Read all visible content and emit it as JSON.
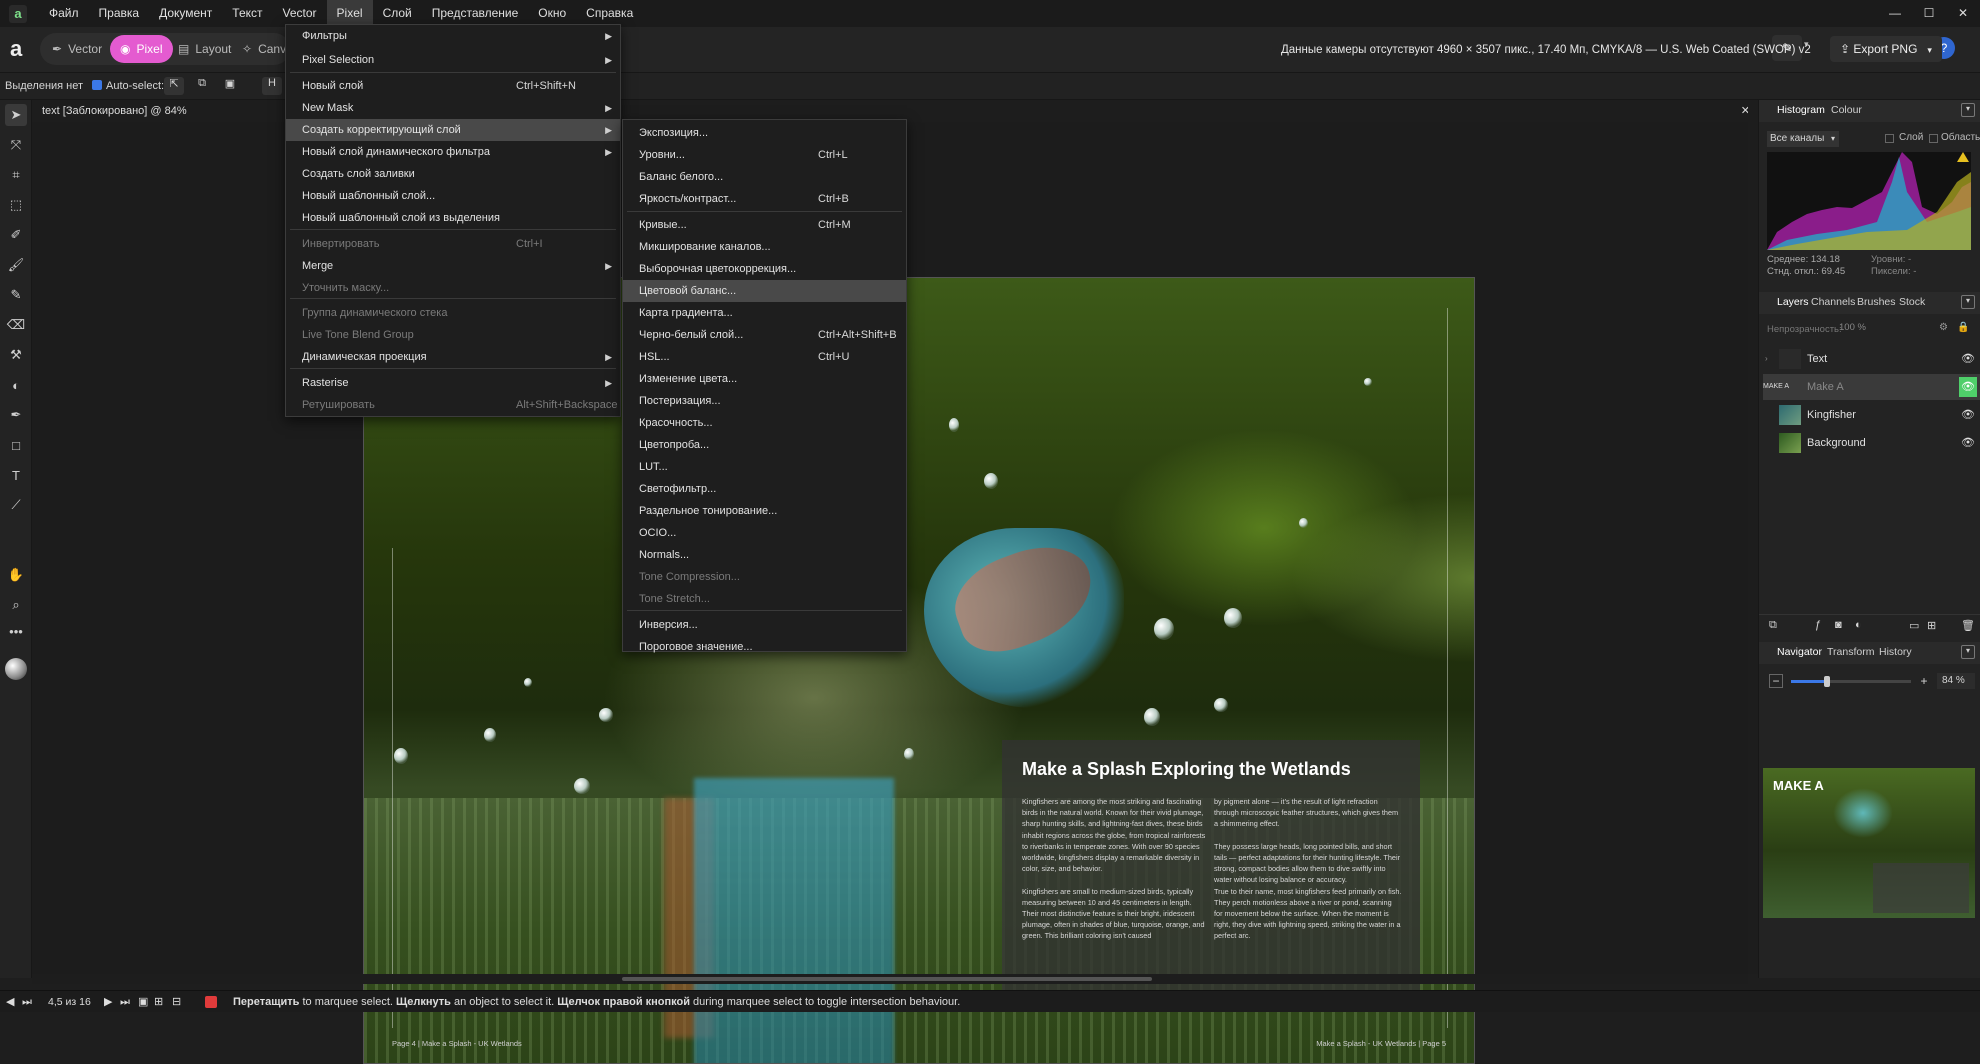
{
  "menubar": {
    "items": [
      "Файл",
      "Правка",
      "Документ",
      "Текст",
      "Vector",
      "Pixel",
      "Слой",
      "Представление",
      "Окно",
      "Справка"
    ],
    "active": "Pixel"
  },
  "toolbar": {
    "personas": [
      "Vector",
      "Pixel",
      "Layout",
      "Canva"
    ],
    "camera_info": "Данные камеры отсутствуют",
    "doc_info": "4960 × 3507 пикс., 17.40 Мп, CMYKA/8 — U.S. Web Coated (SWOP) v2",
    "export_label": "Export PNG"
  },
  "optbar": {
    "selection": "Выделения нет",
    "autoselect": "Auto-select:"
  },
  "document_tab": "text [Заблокировано] @ 84%",
  "pixel_menu": [
    {
      "label": "Фильтры",
      "shortcut": "",
      "submenu": true,
      "disabled": false
    },
    {
      "label": "Pixel Selection",
      "shortcut": "",
      "submenu": true,
      "disabled": false
    },
    {
      "label": "Новый слой",
      "shortcut": "Ctrl+Shift+N",
      "submenu": false,
      "disabled": false
    },
    {
      "label": "New Mask",
      "shortcut": "",
      "submenu": true,
      "disabled": false
    },
    {
      "label": "Создать корректирующий слой",
      "shortcut": "",
      "submenu": true,
      "disabled": false
    },
    {
      "label": "Новый слой динамического фильтра",
      "shortcut": "",
      "submenu": true,
      "disabled": false
    },
    {
      "label": "Создать слой заливки",
      "shortcut": "",
      "submenu": false,
      "disabled": false
    },
    {
      "label": "Новый шаблонный слой...",
      "shortcut": "",
      "submenu": false,
      "disabled": false
    },
    {
      "label": "Новый шаблонный слой из выделения",
      "shortcut": "",
      "submenu": false,
      "disabled": false
    },
    {
      "label": "Инвертировать",
      "shortcut": "Ctrl+I",
      "submenu": false,
      "disabled": true
    },
    {
      "label": "Merge",
      "shortcut": "",
      "submenu": true,
      "disabled": false
    },
    {
      "label": "Уточнить маску...",
      "shortcut": "",
      "submenu": false,
      "disabled": true
    },
    {
      "label": "Группа динамического стека",
      "shortcut": "",
      "submenu": false,
      "disabled": true
    },
    {
      "label": "Live Tone Blend Group",
      "shortcut": "",
      "submenu": false,
      "disabled": true
    },
    {
      "label": "Динамическая проекция",
      "shortcut": "",
      "submenu": true,
      "disabled": false
    },
    {
      "label": "Rasterise",
      "shortcut": "",
      "submenu": true,
      "disabled": false
    },
    {
      "label": "Ретушировать",
      "shortcut": "Alt+Shift+Backspace",
      "submenu": false,
      "disabled": true
    }
  ],
  "adjust_menu": [
    {
      "label": "Экспозиция...",
      "shortcut": "",
      "disabled": false
    },
    {
      "label": "Уровни...",
      "shortcut": "Ctrl+L",
      "disabled": false
    },
    {
      "label": "Баланс белого...",
      "shortcut": "",
      "disabled": false
    },
    {
      "label": "Яркость/контраст...",
      "shortcut": "Ctrl+B",
      "disabled": false
    },
    {
      "label": "Кривые...",
      "shortcut": "Ctrl+M",
      "disabled": false
    },
    {
      "label": "Микширование каналов...",
      "shortcut": "",
      "disabled": false
    },
    {
      "label": "Выборочная цветокоррекция...",
      "shortcut": "",
      "disabled": false
    },
    {
      "label": "Цветовой баланс...",
      "shortcut": "",
      "disabled": false
    },
    {
      "label": "Карта градиента...",
      "shortcut": "",
      "disabled": false
    },
    {
      "label": "Черно-белый слой...",
      "shortcut": "Ctrl+Alt+Shift+B",
      "disabled": false
    },
    {
      "label": "HSL...",
      "shortcut": "Ctrl+U",
      "disabled": false
    },
    {
      "label": "Изменение цвета...",
      "shortcut": "",
      "disabled": false
    },
    {
      "label": "Постеризация...",
      "shortcut": "",
      "disabled": false
    },
    {
      "label": "Красочность...",
      "shortcut": "",
      "disabled": false
    },
    {
      "label": "Цветопроба...",
      "shortcut": "",
      "disabled": false
    },
    {
      "label": "LUT...",
      "shortcut": "",
      "disabled": false
    },
    {
      "label": "Светофильтр...",
      "shortcut": "",
      "disabled": false
    },
    {
      "label": "Раздельное тонирование...",
      "shortcut": "",
      "disabled": false
    },
    {
      "label": "OCIO...",
      "shortcut": "",
      "disabled": false
    },
    {
      "label": "Normals...",
      "shortcut": "",
      "disabled": false
    },
    {
      "label": "Tone Compression...",
      "shortcut": "",
      "disabled": true
    },
    {
      "label": "Tone Stretch...",
      "shortcut": "",
      "disabled": true
    },
    {
      "label": "Инверсия...",
      "shortcut": "",
      "disabled": false
    },
    {
      "label": "Пороговое значение...",
      "shortcut": "",
      "disabled": false
    }
  ],
  "article": {
    "title": "Make a Splash Exploring the Wetlands",
    "col1": "Kingfishers are among the most striking and fascinating birds in the natural world. Known for their vivid plumage, sharp hunting skills, and lightning-fast dives, these birds inhabit regions across the globe, from tropical rainforests to riverbanks in temperate zones. With over 90 species worldwide, kingfishers display a remarkable diversity in color, size, and behavior.\n\nKingfishers are small to medium-sized birds, typically measuring between 10 and 45 centimeters in length. Their most distinctive feature is their bright, iridescent plumage, often in shades of blue, turquoise, orange, and green. This brilliant coloring isn't caused",
    "col2": "by pigment alone — it's the result of light refraction through microscopic feather structures, which gives them a shimmering effect.\n\nThey possess large heads, long pointed bills, and short tails — perfect adaptations for their hunting lifestyle. Their strong, compact bodies allow them to dive swiftly into water without losing balance or accuracy.\n True to their name, most kingfishers feed primarily on fish. They perch motionless above a river or pond, scanning for movement below the surface. When the moment is right, they dive with lightning speed, striking the water in a perfect arc.",
    "footer_left": "Page 4  |  Make a Splash - UK Wetlands",
    "footer_right": "Make a Splash - UK Wetlands  |  Page 5"
  },
  "histogram": {
    "tabs": [
      "Histogram",
      "Colour"
    ],
    "channel": "Все каналы",
    "opt_layer": "Слой",
    "opt_area": "Область",
    "mean": "Среднее: 134.18",
    "stddev": "Стнд. откл.: 69.45",
    "levels": "Уровни: -",
    "pixels": "Пиксели: -"
  },
  "layers": {
    "tabs": [
      "Layers",
      "Channels",
      "Brushes",
      "Stock"
    ],
    "opacity_label": "Непрозрачность:",
    "opacity_value": "100 %",
    "items": [
      {
        "name": "Text",
        "thumb": ""
      },
      {
        "name": "Make A",
        "thumb": "MAKE A"
      },
      {
        "name": "Kingfisher",
        "thumb": ""
      },
      {
        "name": "Background",
        "thumb": ""
      }
    ]
  },
  "navigator": {
    "tabs": [
      "Navigator",
      "Transform",
      "History"
    ],
    "zoom": "84 %",
    "zoom_fraction": 0.3,
    "preview_title": "MAKE A"
  },
  "status": {
    "page": "4,5 из 16",
    "b1": "Перетащить",
    "t1": " to marquee select. ",
    "b2": "Щелкнуть",
    "t2": " an object to select it. ",
    "b3": "Щелчок правой кнопкой",
    "t3": " during marquee select to toggle intersection behaviour."
  },
  "colors": {
    "pixel_persona": "#e45bd0",
    "highlight": "#494949",
    "visible_eye_active": "#4fcf6a"
  }
}
